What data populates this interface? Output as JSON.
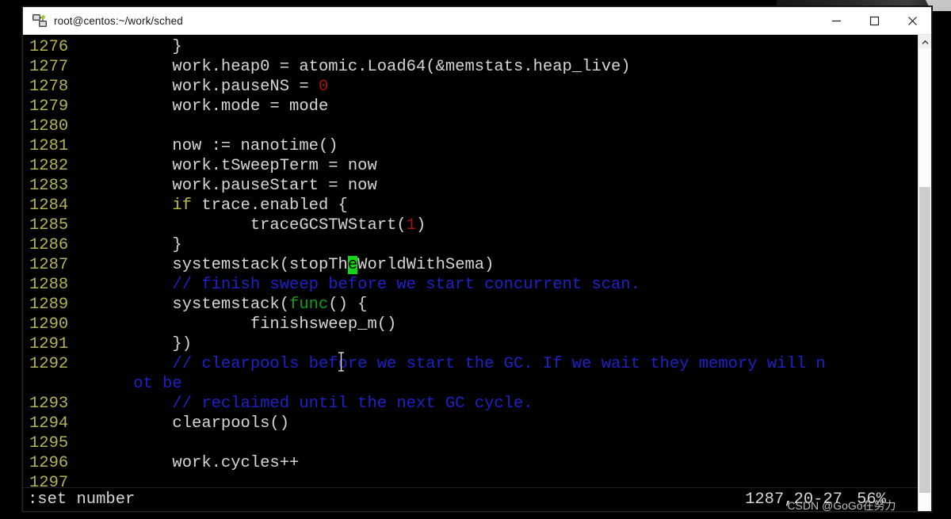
{
  "window": {
    "title": "root@centos:~/work/sched",
    "icon": "putty-network-icon",
    "controls": {
      "minimize_label": "Minimize",
      "maximize_label": "Maximize",
      "close_label": "Close"
    }
  },
  "colors": {
    "background": "#000000",
    "foreground": "#d6d6d6",
    "line_number": "#b3b357",
    "comment": "#2020c8",
    "keyword": "#bdbd4a",
    "func_keyword": "#179c17",
    "number_literal": "#a11414",
    "cursor": "#12d712",
    "titlebar": "#ffffff"
  },
  "editor": {
    "mode": "vim",
    "filetype": "go",
    "lines": [
      {
        "n": "1276",
        "segments": [
          {
            "t": "        }",
            "c": "code"
          }
        ]
      },
      {
        "n": "1277",
        "segments": [
          {
            "t": "        work.heap0 = atomic.Load64(&memstats.heap_live)",
            "c": "code"
          }
        ]
      },
      {
        "n": "1278",
        "segments": [
          {
            "t": "        work.pauseNS = ",
            "c": "code"
          },
          {
            "t": "0",
            "c": "num"
          }
        ]
      },
      {
        "n": "1279",
        "segments": [
          {
            "t": "        work.mode = mode",
            "c": "code"
          }
        ]
      },
      {
        "n": "1280",
        "segments": [
          {
            "t": "",
            "c": "code"
          }
        ]
      },
      {
        "n": "1281",
        "segments": [
          {
            "t": "        now := nanotime()",
            "c": "code"
          }
        ]
      },
      {
        "n": "1282",
        "segments": [
          {
            "t": "        work.tSweepTerm = now",
            "c": "code"
          }
        ]
      },
      {
        "n": "1283",
        "segments": [
          {
            "t": "        work.pauseStart = now",
            "c": "code"
          }
        ]
      },
      {
        "n": "1284",
        "segments": [
          {
            "t": "        ",
            "c": "code"
          },
          {
            "t": "if",
            "c": "kw"
          },
          {
            "t": " trace.enabled {",
            "c": "code"
          }
        ]
      },
      {
        "n": "1285",
        "segments": [
          {
            "t": "                traceGCSTWStart(",
            "c": "code"
          },
          {
            "t": "1",
            "c": "num"
          },
          {
            "t": ")",
            "c": "code"
          }
        ]
      },
      {
        "n": "1286",
        "segments": [
          {
            "t": "        }",
            "c": "code"
          }
        ]
      },
      {
        "n": "1287",
        "segments": [
          {
            "t": "        systemstack(stopTh",
            "c": "code"
          },
          {
            "t": "e",
            "c": "cursor-block"
          },
          {
            "t": "WorldWithSema)",
            "c": "code"
          }
        ]
      },
      {
        "n": "1288",
        "segments": [
          {
            "t": "        // finish sweep before we start concurrent scan.",
            "c": "cmt"
          }
        ]
      },
      {
        "n": "1289",
        "segments": [
          {
            "t": "        systemstack(",
            "c": "code"
          },
          {
            "t": "func",
            "c": "kw-func"
          },
          {
            "t": "() {",
            "c": "code"
          }
        ]
      },
      {
        "n": "1290",
        "segments": [
          {
            "t": "                finishsweep_m()",
            "c": "code"
          }
        ]
      },
      {
        "n": "1291",
        "segments": [
          {
            "t": "        })",
            "c": "code"
          }
        ]
      },
      {
        "n": "1292",
        "segments": [
          {
            "t": "        // clearpools before we start the GC. If we wait they memory will n",
            "c": "cmt"
          }
        ]
      },
      {
        "n": "",
        "segments": [
          {
            "t": "    ot be",
            "c": "cmt"
          }
        ]
      },
      {
        "n": "1293",
        "segments": [
          {
            "t": "        // reclaimed until the next GC cycle.",
            "c": "cmt"
          }
        ]
      },
      {
        "n": "1294",
        "segments": [
          {
            "t": "        clearpools()",
            "c": "code"
          }
        ]
      },
      {
        "n": "1295",
        "segments": [
          {
            "t": "",
            "c": "code"
          }
        ]
      },
      {
        "n": "1296",
        "segments": [
          {
            "t": "        work.cycles++",
            "c": "code"
          }
        ]
      },
      {
        "n": "1297",
        "segments": [
          {
            "t": "",
            "c": "code"
          }
        ]
      }
    ]
  },
  "statusline": {
    "command": ":set number",
    "ruler": "1287,20-27",
    "percent": "56%"
  },
  "scrollbar": {
    "up_arrow_icon": "chevron-up-icon",
    "thumb_top_percent": 30,
    "thumb_height_percent": 66
  },
  "watermark": {
    "text": "CSDN @GoGo在努力"
  }
}
